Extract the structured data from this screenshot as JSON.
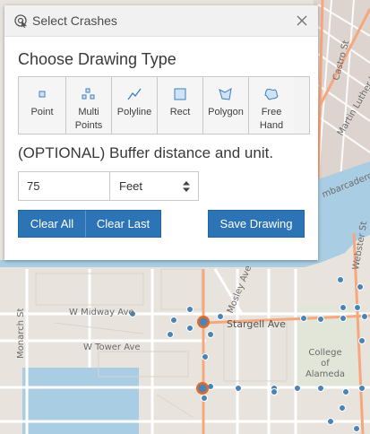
{
  "panel": {
    "title": "Select Crashes",
    "header_icon": "select-crashes-icon",
    "close_icon": "close-icon",
    "choose_title": "Choose Drawing Type",
    "tools": [
      {
        "label": "Point",
        "icon": "point-icon"
      },
      {
        "label": "Multi Points",
        "icon": "multipoint-icon"
      },
      {
        "label": "Polyline",
        "icon": "polyline-icon"
      },
      {
        "label": "Rect",
        "icon": "rectangle-icon"
      },
      {
        "label": "Polygon",
        "icon": "polygon-icon"
      },
      {
        "label": "Free Hand",
        "icon": "freehand-icon"
      }
    ],
    "buffer_title": "(OPTIONAL) Buffer distance and unit.",
    "distance_value": "75",
    "unit_value": "Feet",
    "clear_all_label": "Clear All",
    "clear_last_label": "Clear Last",
    "save_label": "Save Drawing"
  },
  "map": {
    "labels": {
      "w_midway_ave": "W Midway Ave",
      "stargell_ave": "Stargell Ave",
      "w_tower_ave": "W Tower Ave",
      "monarch_st": "Monarch St",
      "mosley_ave": "Mosley Ave",
      "college_of_alameda": "College of Alameda",
      "webster_st": "Webster St",
      "castro_st": "Castro St",
      "martin_luther_king_jr_way": "Martin Luther King Jr Way",
      "embarcadero_st": "mbarcadero St"
    },
    "colors": {
      "land": "#e8e4dd",
      "water": "#a9cde3",
      "road": "#ffffff",
      "major_road": "#f6a77e",
      "crash_point": "#4a84b6",
      "crash_highlight": "#e06a2a"
    }
  }
}
